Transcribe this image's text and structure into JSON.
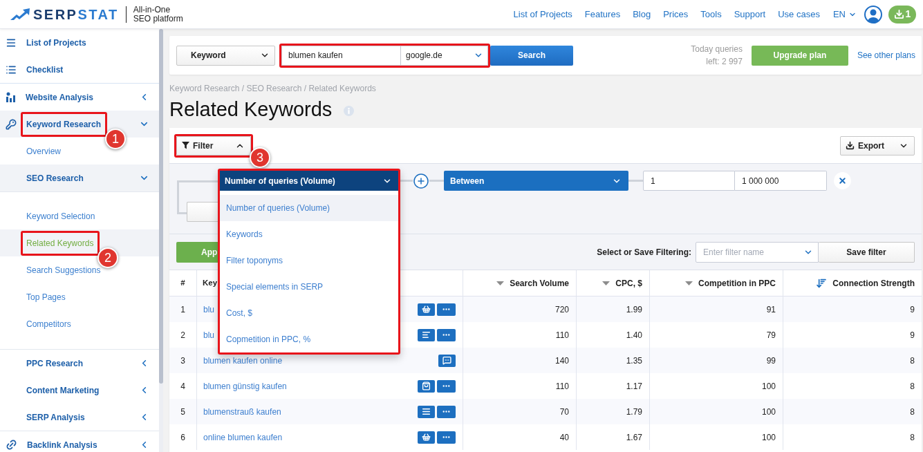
{
  "header": {
    "logo": {
      "part_1": "SERP",
      "part_2": "STAT"
    },
    "tagline": [
      "All-in-One",
      "SEO platform"
    ],
    "nav": [
      "List of Projects",
      "Features",
      "Blog",
      "Prices",
      "Tools",
      "Support",
      "Use cases"
    ],
    "language": "EN",
    "downloads_count": "1"
  },
  "sidebar": {
    "sections": [
      {
        "items": [
          {
            "label": "List of Projects",
            "selected": false
          },
          {
            "label": "Checklist",
            "selected": false
          }
        ]
      },
      {
        "items": [
          {
            "label": "Website Analysis",
            "expanded": false
          },
          {
            "label": "Keyword Research",
            "expanded": true,
            "callout": "1",
            "children": [
              {
                "label": "Overview",
                "selected": false
              },
              {
                "label": "SEO Research",
                "expanded": true,
                "children": [
                  {
                    "label": "Keyword Selection",
                    "selected": false
                  },
                  {
                    "label": "Related Keywords",
                    "selected": true,
                    "callout": "2"
                  },
                  {
                    "label": "Search Suggestions",
                    "selected": false
                  },
                  {
                    "label": "Top Pages",
                    "selected": false
                  },
                  {
                    "label": "Competitors",
                    "selected": false
                  }
                ]
              },
              {
                "label": "PPC Research",
                "expanded": false
              },
              {
                "label": "Content Marketing",
                "expanded": false
              },
              {
                "label": "SERP Analysis",
                "expanded": false
              }
            ]
          },
          {
            "label": "Backlink Analysis",
            "expanded": false
          }
        ]
      }
    ]
  },
  "search_bar": {
    "type_select": "Keyword",
    "query": "blumen kaufen",
    "engine_select": "google.de",
    "framed": true,
    "search_button": "Search",
    "quota": "Today queries left: 2 997",
    "upgrade_button": "Upgrade plan",
    "plans_link": "See other plans"
  },
  "breadcrumb": "Keyword Research / SEO Research / Related Keywords",
  "page_title": "Related Keywords",
  "filter_panel": {
    "filter_button": {
      "label": "Filter",
      "expanded": true,
      "callout": "3"
    },
    "export_button": "Export",
    "condition": {
      "field_select": {
        "value": "Number of queries (Volume)",
        "expanded": true,
        "framed": true,
        "options": [
          {
            "label": "Number of queries (Volume)",
            "selected": true
          },
          {
            "label": "Keywords",
            "selected": false
          },
          {
            "label": "Filter toponyms",
            "selected": false
          },
          {
            "label": "Special elements in SERP",
            "selected": false
          },
          {
            "label": "Cost, $",
            "selected": false
          },
          {
            "label": "Copmetition in PPC, %",
            "selected": false
          }
        ]
      },
      "operator_select": "Between",
      "range_from": "1",
      "range_to": "1 000 000"
    },
    "apply_button": "App",
    "save_label": "Select or Save Filtering:",
    "filter_name_placeholder": "Enter filter name",
    "save_button": "Save filter"
  },
  "table": {
    "columns": [
      {
        "label": "#"
      },
      {
        "label": "Key"
      },
      {
        "label": "Search Volume",
        "sorted": false
      },
      {
        "label": "CPC, $",
        "sorted": false
      },
      {
        "label": "Competition in PPC",
        "sorted": false
      },
      {
        "label": "Connection Strength",
        "sorted": true
      }
    ],
    "rows": [
      {
        "number": "1",
        "keyword": "blu",
        "features": [
          {
            "kind": "basket"
          },
          {
            "kind": "more"
          }
        ],
        "search_volume": "720",
        "cpc": "1.99",
        "competition": "91",
        "connection_strength": "9"
      },
      {
        "number": "2",
        "keyword": "blu",
        "features": [
          {
            "kind": "lines"
          },
          {
            "kind": "more"
          }
        ],
        "search_volume": "110",
        "cpc": "1.40",
        "competition": "79",
        "connection_strength": "9"
      },
      {
        "number": "3",
        "keyword": "blumen kaufen online",
        "features": [
          {
            "kind": "chat"
          }
        ],
        "search_volume": "140",
        "cpc": "1.35",
        "competition": "99",
        "connection_strength": "8"
      },
      {
        "number": "4",
        "keyword": "blumen günstig kaufen",
        "features": [
          {
            "kind": "bag"
          },
          {
            "kind": "more"
          }
        ],
        "search_volume": "110",
        "cpc": "1.17",
        "competition": "100",
        "connection_strength": "8"
      },
      {
        "number": "5",
        "keyword": "blumenstrauß kaufen",
        "features": [
          {
            "kind": "list"
          },
          {
            "kind": "more"
          }
        ],
        "search_volume": "70",
        "cpc": "1.79",
        "competition": "100",
        "connection_strength": "8"
      },
      {
        "number": "6",
        "keyword": "online blumen kaufen",
        "features": [
          {
            "kind": "basket"
          },
          {
            "kind": "more"
          }
        ],
        "search_volume": "40",
        "cpc": "1.67",
        "competition": "100",
        "connection_strength": "8"
      }
    ]
  }
}
